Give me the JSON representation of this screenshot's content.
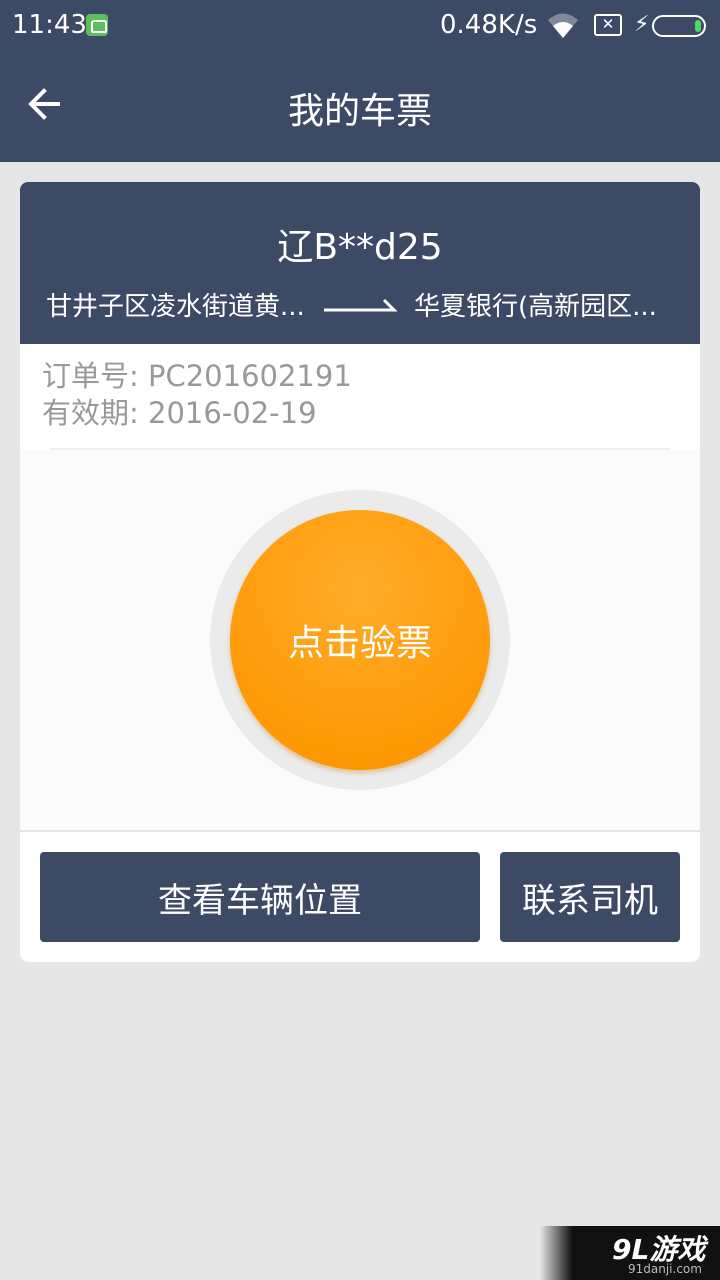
{
  "status_bar": {
    "time": "11:43",
    "net_speed": "0.48K/s",
    "icons": [
      "app-notification-icon",
      "wifi-icon",
      "sim-card-missing-icon",
      "charging-bolt-icon",
      "battery-icon"
    ],
    "sim_mark": "✕",
    "bolt": "⚡"
  },
  "header": {
    "title": "我的车票",
    "back_icon": "back-arrow-icon"
  },
  "ticket": {
    "plate": "辽B**d25",
    "route_from": "甘井子区凌水街道黄...",
    "route_to": "华夏银行(高新园区...",
    "order_line": "订单号: PC201602191",
    "valid_line": "有效期: 2016-02-19",
    "check_button": "点击验票"
  },
  "actions": {
    "view_location": "查看车辆位置",
    "contact_driver": "联系司机"
  },
  "watermark": {
    "logo": "9L游戏",
    "url": "91danji.com"
  },
  "colors": {
    "header_bg": "#3c4a66",
    "page_bg": "#e6e6e6",
    "accent_orange": "#ff9a06",
    "muted_text": "#999999"
  }
}
